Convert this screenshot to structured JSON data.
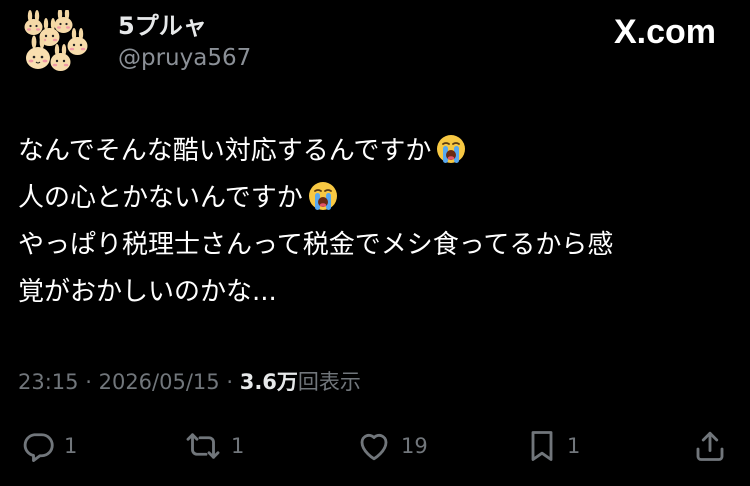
{
  "author": {
    "display_name": "5プルャ",
    "handle": "@pruya567"
  },
  "brand": {
    "text": "X.com"
  },
  "tweet": {
    "lines": [
      "なんでそんな酷い対応するんですか",
      "人の心とかないんですか",
      "やっぱり税理士さんって税金でメシ食ってるから感",
      "覚がおかしいのかな..."
    ],
    "emoji": "loudly-crying-face"
  },
  "meta": {
    "time": "23:15",
    "separator1": "·",
    "date": "2026/05/15",
    "separator2": "·",
    "views_count": "3.6万",
    "views_label": "回表示"
  },
  "actions": {
    "reply_count": "1",
    "repost_count": "1",
    "like_count": "19",
    "bookmark_count": "1"
  },
  "colors": {
    "background": "#000000",
    "text": "#ffffff",
    "secondary": "#71767b"
  }
}
